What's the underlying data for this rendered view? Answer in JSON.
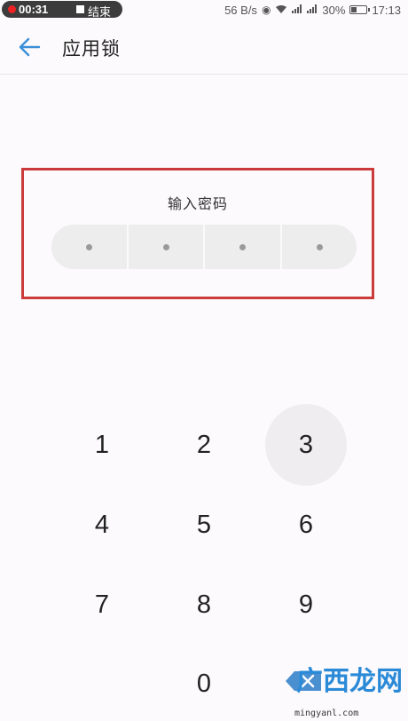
{
  "status_bar": {
    "recording_time": "00:31",
    "recording_end_label": "结束",
    "network_speed": "56 B/s",
    "battery_percent": "30%",
    "time": "17:13",
    "battery_level": 0.3
  },
  "header": {
    "back_icon": "back-arrow-icon",
    "title": "应用锁"
  },
  "password": {
    "label": "输入密码",
    "pin_length": 4,
    "entered": 0
  },
  "keypad": {
    "keys": [
      "1",
      "2",
      "3",
      "4",
      "5",
      "6",
      "7",
      "8",
      "9",
      "0"
    ],
    "pressed_key": "3",
    "delete_icon": "backspace-icon"
  },
  "watermark": {
    "text": "广西龙网",
    "url": "mingyanl.com"
  },
  "colors": {
    "accent": "#3a8fd9",
    "highlight_border": "#cc3b3b",
    "background": "#fcfafc"
  }
}
